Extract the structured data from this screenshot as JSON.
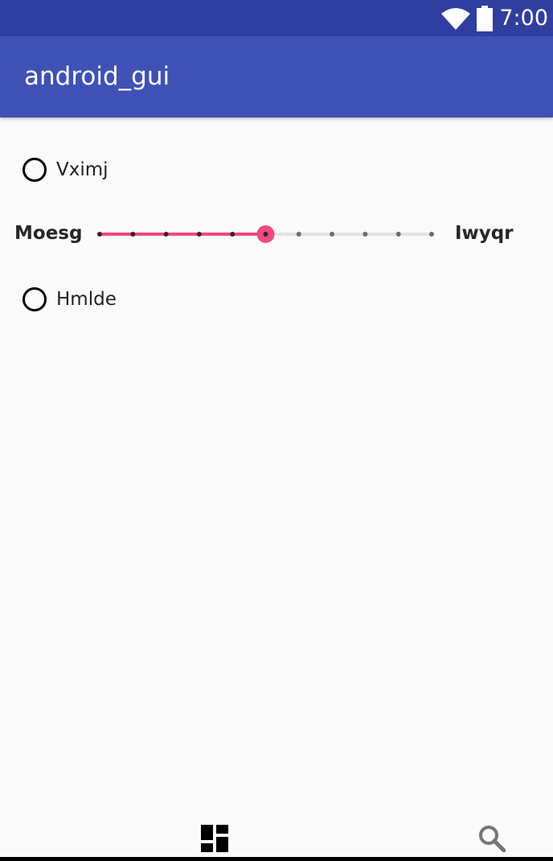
{
  "status_bar": {
    "time": "7:00",
    "icons": [
      "wifi-icon",
      "battery-icon"
    ],
    "background": "#303F9F"
  },
  "app_bar": {
    "title": "android_gui",
    "background": "#3F51B5"
  },
  "radio_1": {
    "label": "Vximj",
    "checked": false
  },
  "seekbar": {
    "left_label": "Moesg",
    "right_label": "Iwyqr",
    "steps": 10,
    "value": 5,
    "accent": "#F04A82"
  },
  "radio_2": {
    "label": "Hmlde",
    "checked": false
  },
  "bottom_nav": {
    "items": [
      "dashboard-icon",
      "search-icon"
    ]
  }
}
